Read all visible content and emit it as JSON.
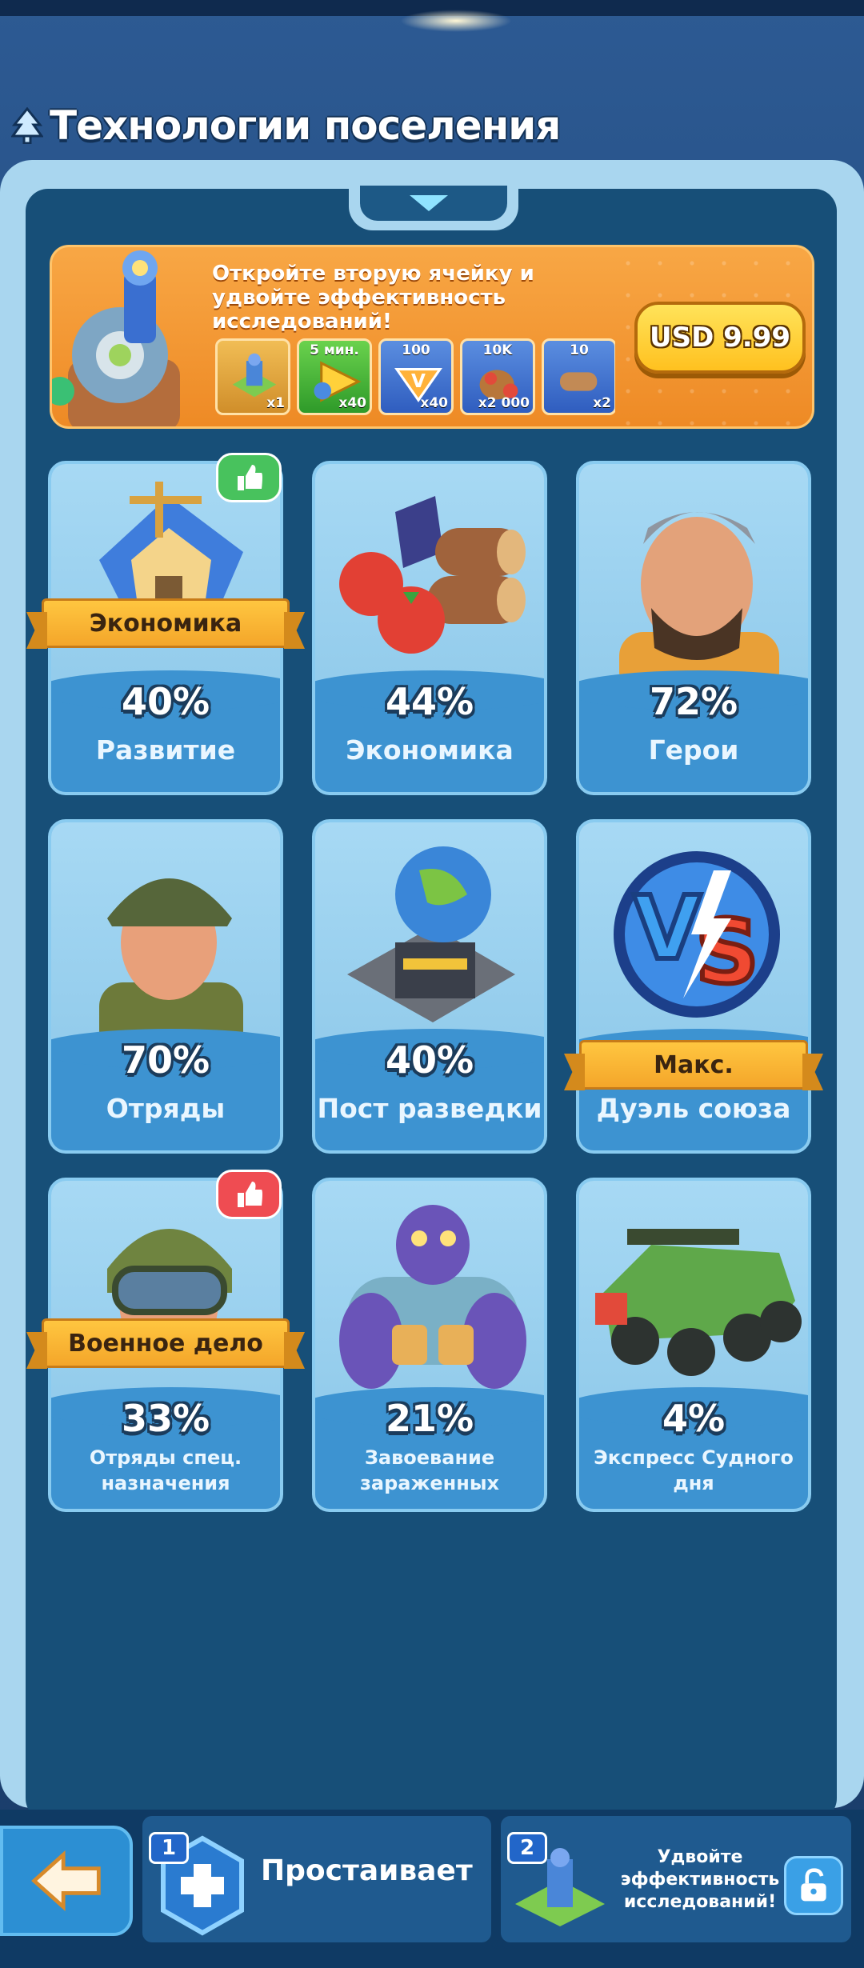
{
  "header": {
    "title": "Технологии поселения"
  },
  "offer": {
    "text": "Откройте вторую ячейку и удвойте эффективность исследований!",
    "price": "USD 9.99",
    "items": [
      {
        "top": "",
        "qty": "x1"
      },
      {
        "top": "5 мин.",
        "qty": "x40"
      },
      {
        "top": "100",
        "qty": "x40"
      },
      {
        "top": "10K",
        "qty": "x2 000"
      },
      {
        "top": "10",
        "qty": "x2"
      }
    ]
  },
  "cards": [
    {
      "name": "Развитие",
      "percent": "40%",
      "ribbon": "Экономика",
      "recommended": true
    },
    {
      "name": "Экономика",
      "percent": "44%"
    },
    {
      "name": "Герои",
      "percent": "72%"
    },
    {
      "name": "Отряды",
      "percent": "70%"
    },
    {
      "name": "Пост разведки",
      "percent": "40%"
    },
    {
      "name": "Дуэль союза",
      "ribbon": "Макс."
    },
    {
      "name": "Отряды спец. назначения",
      "percent": "33%",
      "ribbon": "Военное дело",
      "recommended": true
    },
    {
      "name": "Завоевание зараженных",
      "percent": "21%"
    },
    {
      "name": "Экспресс Судного дня",
      "percent": "4%"
    }
  ],
  "bottom": {
    "slot1": {
      "num": "1",
      "label": "Простаивает"
    },
    "slot2": {
      "num": "2",
      "label": "Удвойте эффективность исследований!"
    }
  },
  "colors": {
    "panel": "#174f78",
    "card": "#6fb6e3",
    "ribbon": "#f4a62a",
    "offer": "#f39a34"
  }
}
